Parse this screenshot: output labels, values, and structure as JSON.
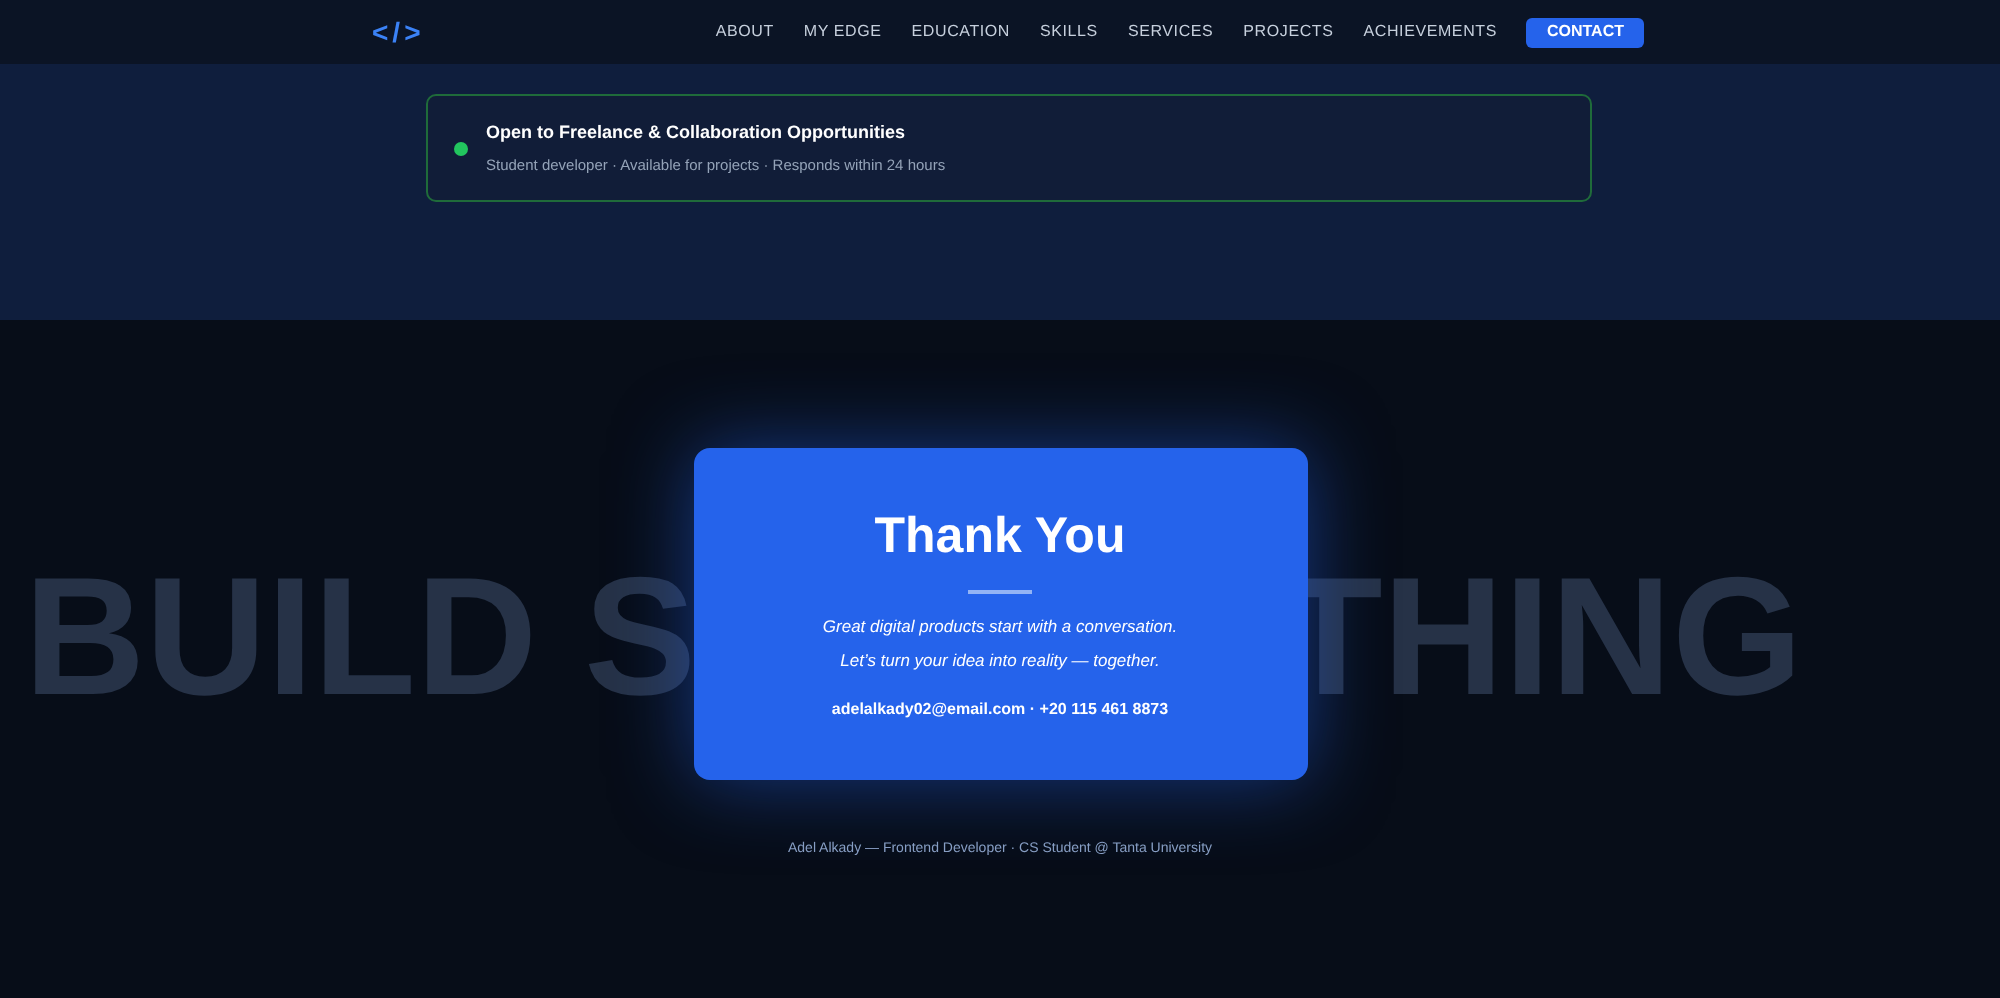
{
  "nav": {
    "logo": "</>",
    "links": [
      {
        "label": "ABOUT"
      },
      {
        "label": "MY EDGE"
      },
      {
        "label": "EDUCATION"
      },
      {
        "label": "SKILLS"
      },
      {
        "label": "SERVICES"
      },
      {
        "label": "PROJECTS"
      },
      {
        "label": "ACHIEVEMENTS"
      }
    ],
    "cta": "CONTACT"
  },
  "availability": {
    "title": "Open to Freelance & Collaboration Opportunities",
    "subtitle": "Student developer · Available for projects · Responds within 24 hours",
    "color": "#22c55e"
  },
  "backdrop": {
    "left": "BUILD S",
    "right": "THING"
  },
  "card": {
    "title": "Thank You",
    "lines": [
      "Great digital products start with a conversation.",
      "Let’s turn your idea into reality — together."
    ],
    "contact": "adelalkady02@email.com · +20 115 461 8873"
  },
  "footer": "Adel Alkady — Frontend Developer · CS Student @ Tanta University"
}
